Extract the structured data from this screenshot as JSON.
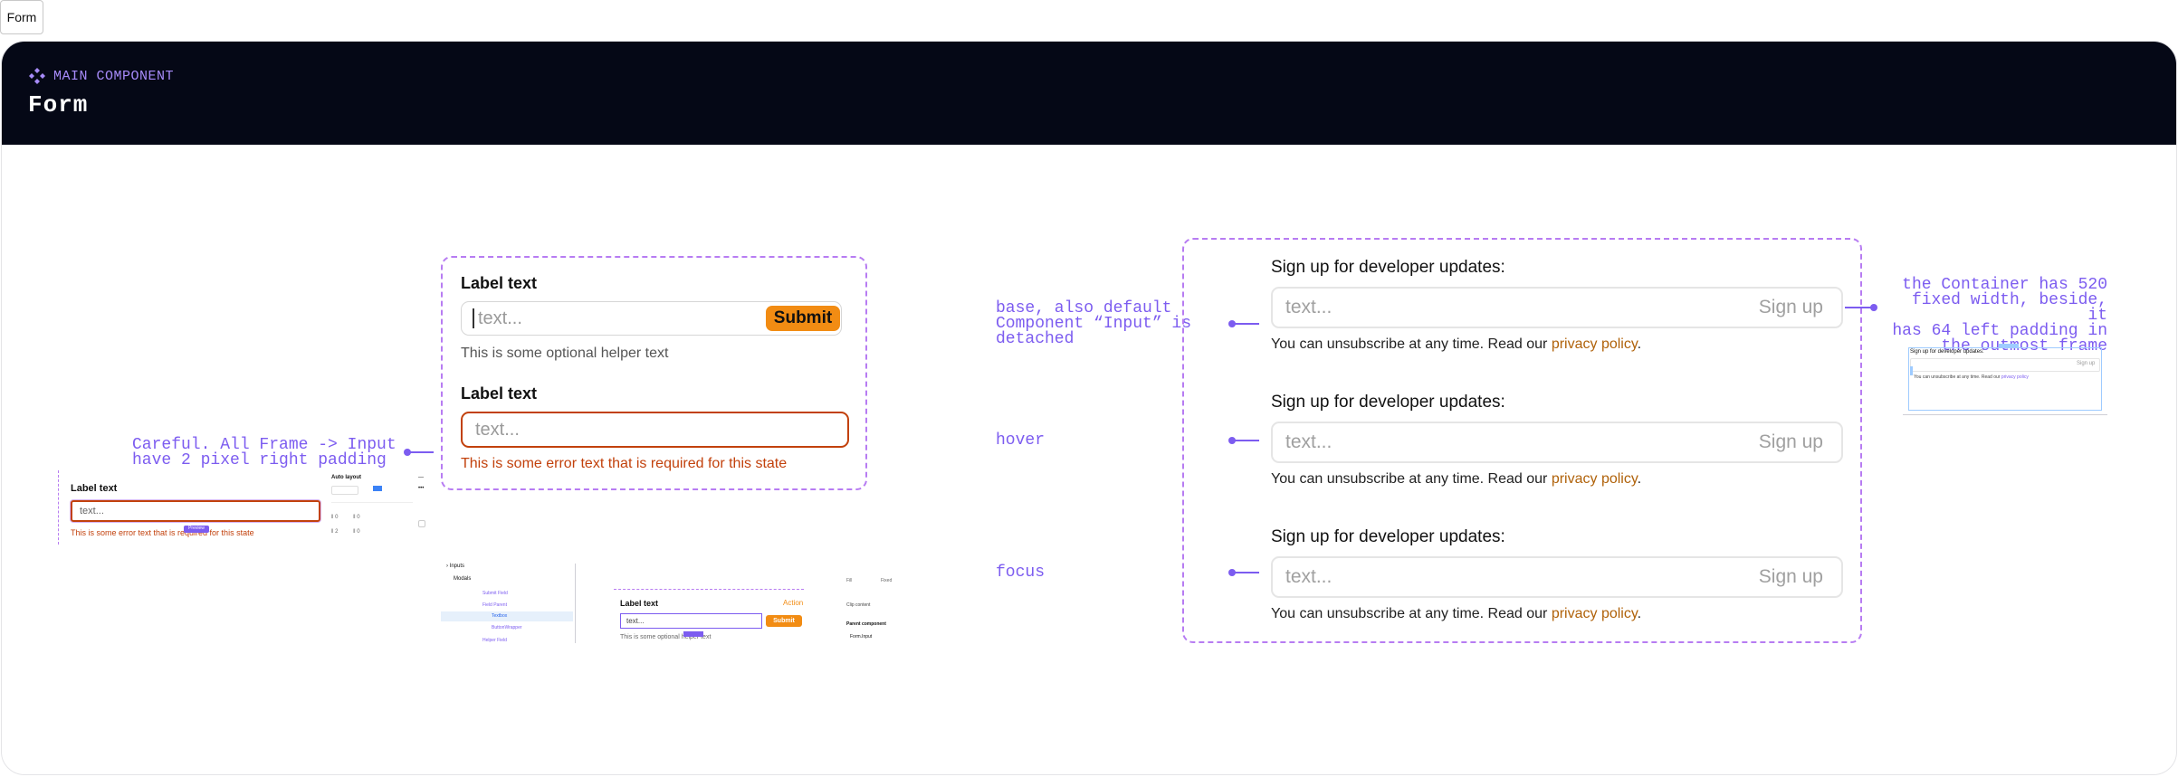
{
  "page_tab": "Form",
  "hero": {
    "kicker": "MAIN COMPONENT",
    "title": "Form"
  },
  "left_note": {
    "line1": "Careful. All Frame -> Input",
    "line2": "have 2 pixel right padding"
  },
  "thumb_left": {
    "label": "Label text",
    "placeholder": "text...",
    "error": "This is some error text that is required for this state",
    "panel_title": "Auto layout",
    "badge": "Preview"
  },
  "form_card": {
    "label1": "Label text",
    "placeholder1": "text...",
    "submit": "Submit",
    "helper": "This is some optional helper text",
    "label2": "Label text",
    "placeholder2": "text...",
    "error": "This is some error text that is required for this state"
  },
  "thumb_mid": {
    "layers": [
      "Inputs",
      "Modals",
      "Submit Field",
      "Field Parent",
      "Textbox",
      "ButtonWrapper",
      "Helper Field"
    ],
    "label": "Label text",
    "action": "Action",
    "placeholder": "text...",
    "submit": "Submit",
    "helper": "This is some optional helper text",
    "props": [
      "Fill",
      "Fixed",
      "Clip content",
      "Parent component",
      "Form.Input"
    ]
  },
  "state_notes": {
    "base": [
      "base, also default",
      "Component “Input” is",
      "detached"
    ],
    "hover": "hover",
    "focus": "focus"
  },
  "signup": {
    "title": "Sign up for developer updates:",
    "placeholder": "text...",
    "button": "Sign up",
    "foot_prefix": "You can unsubscribe at any time. Read our ",
    "link": "privacy policy",
    "foot_suffix": "."
  },
  "right_note": [
    "the Container has 520",
    "fixed width, beside, it",
    "has 64 left padding in",
    "the outmost frame"
  ],
  "thumb_right": {
    "title": "Sign up for developer updates:",
    "button": "Sign up",
    "foot_prefix": "You can unsubscribe at any time. Read our ",
    "link": "privacy policy"
  },
  "colors": {
    "accent": "#7c5cf0",
    "dash": "#b77cf2",
    "orange": "#f28c13",
    "error": "#c2410c",
    "hero_bg": "#050816"
  }
}
